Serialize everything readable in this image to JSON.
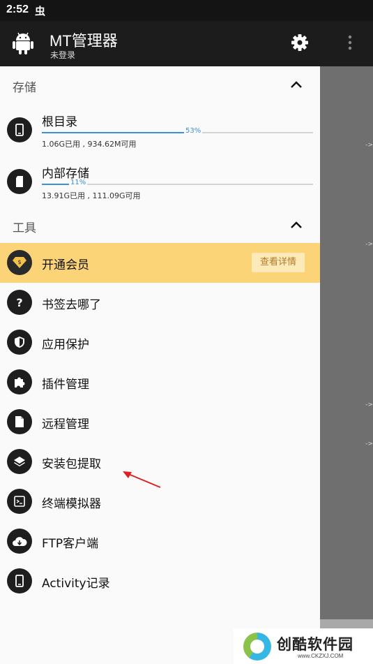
{
  "status_bar": {
    "time": "2:52",
    "bug_glyph": "虫"
  },
  "app_bar": {
    "title": "MT管理器",
    "subtitle": "未登录",
    "icons": [
      "android-icon",
      "moon-icon",
      "gear-icon",
      "more-vert-icon"
    ]
  },
  "storage_section": {
    "header": "存储",
    "items": [
      {
        "name": "根目录",
        "percent_label": "53%",
        "usage": "1.06G已用 , 934.62M可用",
        "used_fraction": 0.53,
        "icon": "phone-icon"
      },
      {
        "name": "内部存储",
        "percent_label": "11%",
        "usage": "13.91G已用 , 111.09G可用",
        "used_fraction": 0.11,
        "icon": "sd-card-icon"
      }
    ]
  },
  "tools_section": {
    "header": "工具",
    "vip": {
      "label": "开通会员",
      "button": "查看详情",
      "icon": "diamond-icon"
    },
    "items": [
      {
        "label": "书签去哪了",
        "icon": "question-icon"
      },
      {
        "label": "应用保护",
        "icon": "shield-icon"
      },
      {
        "label": "插件管理",
        "icon": "puzzle-icon"
      },
      {
        "label": "远程管理",
        "icon": "file-icon"
      },
      {
        "label": "安装包提取",
        "icon": "layers-icon"
      },
      {
        "label": "终端模拟器",
        "icon": "terminal-icon"
      },
      {
        "label": "FTP客户端",
        "icon": "cloud-icon"
      },
      {
        "label": "Activity记录",
        "icon": "phone-icon"
      }
    ]
  },
  "watermark": {
    "brand": "创酷软件园",
    "url": "www.CKZXJ.COM"
  },
  "colors": {
    "vip_background": "#fbd477",
    "progress": "#3c8fd9",
    "app_bar": "#1c1c1c"
  }
}
